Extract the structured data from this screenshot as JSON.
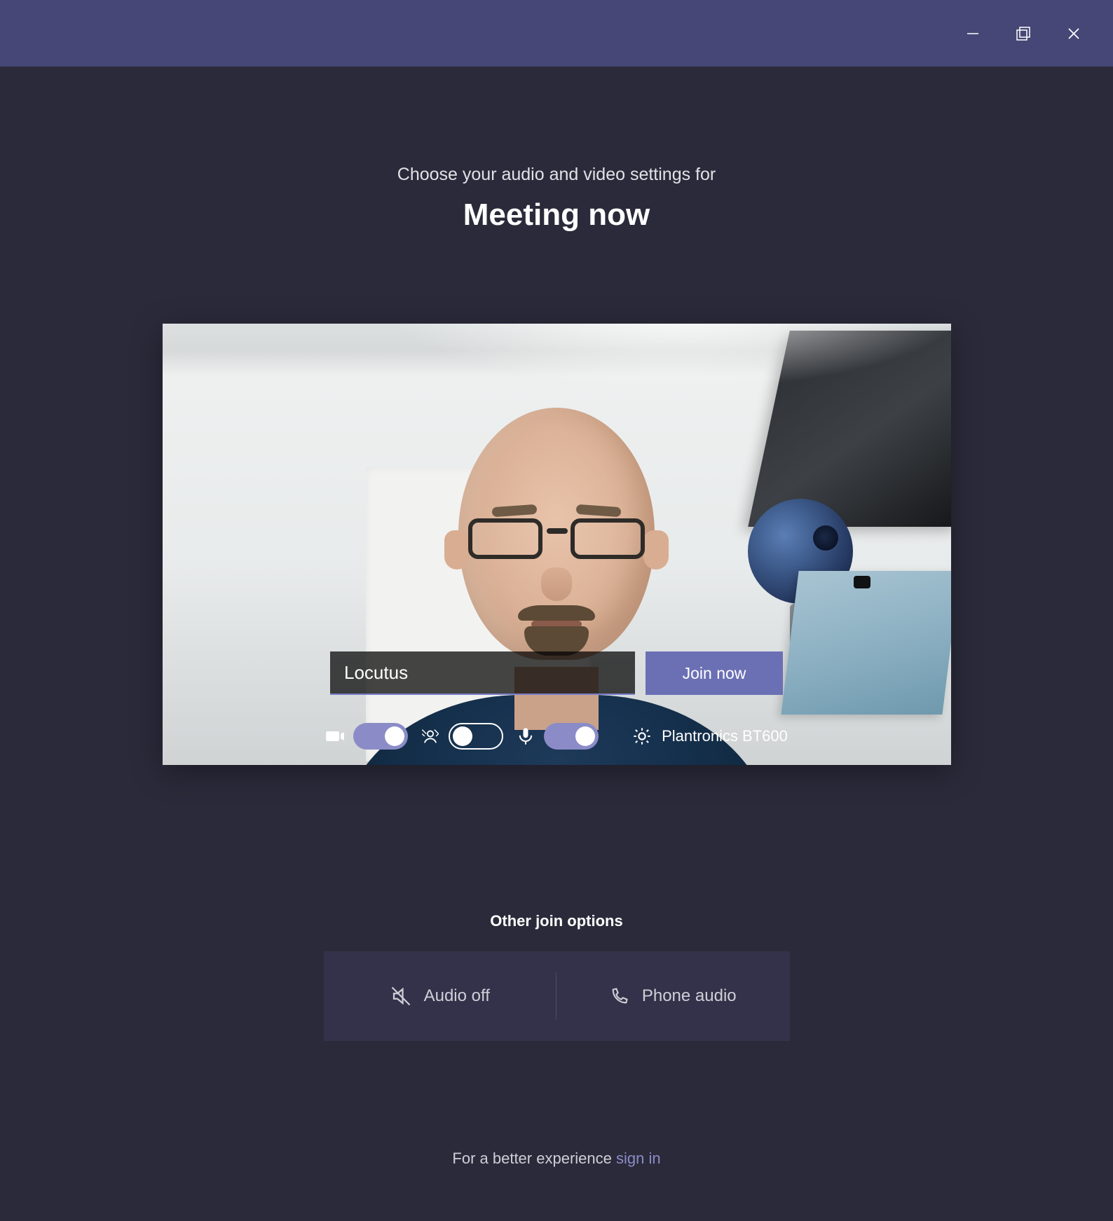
{
  "header": {
    "subtitle": "Choose your audio and video settings for",
    "title": "Meeting now"
  },
  "name_input": {
    "value": "Locutus"
  },
  "join_button": "Join now",
  "toggles": {
    "camera_on": true,
    "background_on": false,
    "mic_on": true
  },
  "device": {
    "label": "Plantronics BT600"
  },
  "other_options": {
    "title": "Other join options",
    "audio_off": "Audio off",
    "phone_audio": "Phone audio"
  },
  "footer": {
    "text": "For a better experience ",
    "link": "sign in"
  }
}
